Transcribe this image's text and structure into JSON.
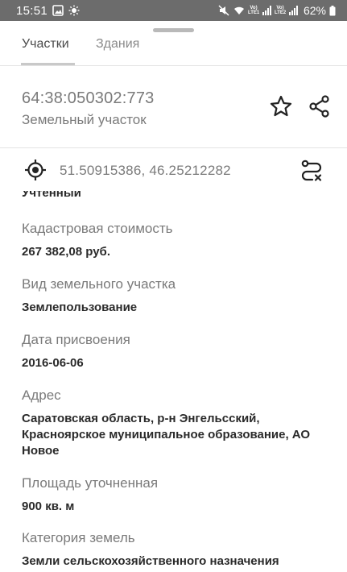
{
  "status_bar": {
    "time": "15:51",
    "battery": "62%",
    "sim1_label": "Vo) LTE1",
    "sim2_label": "Vo) LTE2"
  },
  "tabs": [
    {
      "label": "Участки",
      "active": true
    },
    {
      "label": "Здания",
      "active": false
    }
  ],
  "header": {
    "cadastral_number": "64:38:050302:773",
    "object_type": "Земельный участок"
  },
  "coordinates": {
    "text": "51.50915386, 46.25212282"
  },
  "info": {
    "clipped_value": "Учтенный",
    "fields": [
      {
        "label": "Кадастровая стоимость",
        "value": "267 382,08 руб."
      },
      {
        "label": "Вид земельного участка",
        "value": "Землепользование"
      },
      {
        "label": "Дата присвоения",
        "value": "2016-06-06"
      },
      {
        "label": "Адрес",
        "value": "Саратовская область, р-н Энгельсский, Красноярское муниципальное образование, АО Новое"
      },
      {
        "label": "Площадь уточненная",
        "value": "900 кв. м"
      },
      {
        "label": "Категория земель",
        "value": "Земли сельскохозяйственного назначения"
      }
    ]
  },
  "icons": {
    "star": "star-outline-icon",
    "share": "share-icon",
    "location": "crosshair-icon",
    "route": "route-icon"
  },
  "colors": {
    "status_bar": "#6c6c6c",
    "label_gray": "#7a7a7a",
    "value_dark": "#2a2a2a"
  }
}
